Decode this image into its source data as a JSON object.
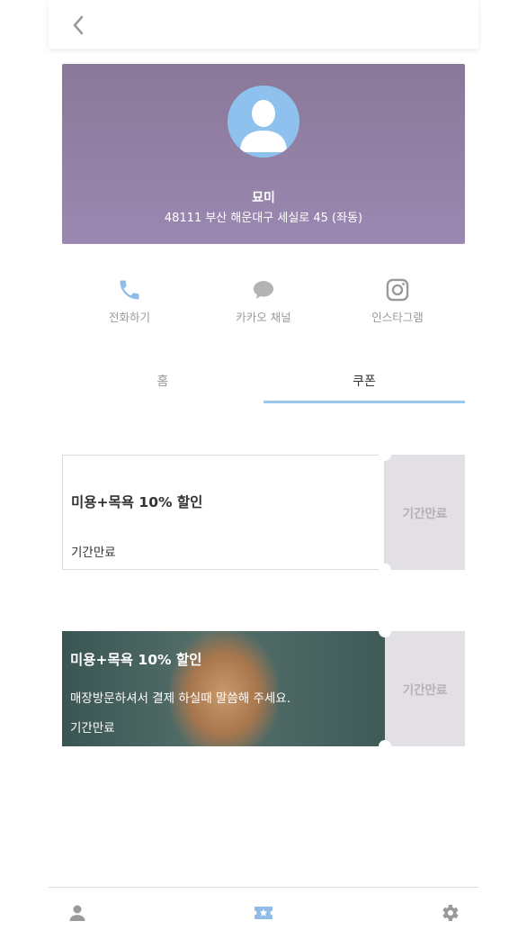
{
  "header": {
    "back_icon": "chevron-left-icon"
  },
  "profile": {
    "name": "묘미",
    "address": "48111 부산 해운대구 세실로 45 (좌동)",
    "avatar_icon": "user-icon",
    "bg_color": "#8f7da3"
  },
  "actions": [
    {
      "label": "전화하기",
      "icon": "phone-icon"
    },
    {
      "label": "카카오 채널",
      "icon": "chat-bubble-icon"
    },
    {
      "label": "인스타그램",
      "icon": "instagram-icon"
    }
  ],
  "tabs": [
    {
      "label": "홈",
      "active": false
    },
    {
      "label": "쿠폰",
      "active": true
    }
  ],
  "coupons": [
    {
      "title": "미용+목욕 10% 할인",
      "description": "",
      "expiry": "기간만료",
      "status": "기간만료"
    },
    {
      "title": "미용+목욕 10% 할인",
      "description": "매장방문하셔서 결제 하실때 말씀해 주세요.",
      "expiry": "기간만료",
      "status": "기간만료"
    }
  ],
  "bottom_nav": [
    {
      "icon": "person-icon",
      "active": false
    },
    {
      "icon": "ticket-star-icon",
      "active": true
    },
    {
      "icon": "gear-icon",
      "active": false
    }
  ],
  "colors": {
    "accent": "#9cc6ea",
    "status_bg": "#e2e0e4"
  }
}
